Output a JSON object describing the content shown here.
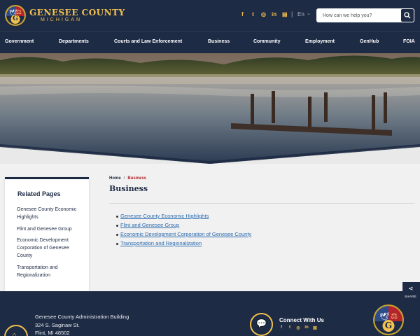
{
  "header": {
    "logo_title": "GENESEE COUNTY",
    "logo_subtitle": "MICHIGAN",
    "social": [
      {
        "icon": "facebook-icon",
        "glyph": "f"
      },
      {
        "icon": "twitter-icon",
        "glyph": "t"
      },
      {
        "icon": "instagram-icon",
        "glyph": "◎"
      },
      {
        "icon": "linkedin-icon",
        "glyph": "in"
      },
      {
        "icon": "news-icon",
        "glyph": "▤"
      }
    ],
    "language": "En",
    "language_caret": "⌄",
    "search_placeholder": "How can we help you?"
  },
  "nav": {
    "items": [
      "Government",
      "Departments",
      "Courts and Law Enforcement",
      "Business",
      "Community",
      "Employment",
      "GenHub",
      "FOIA"
    ]
  },
  "sidebar": {
    "title": "Related Pages",
    "links": [
      "Genesee County Economic Highlights",
      "Flint and Genesee Group",
      "Economic Development Corporation of Genesee County",
      "Transportation and Regionalization"
    ]
  },
  "breadcrumb": {
    "home": "Home",
    "separator": "/",
    "current": "Business"
  },
  "page_title": "Business",
  "content_links": [
    "Genesee County Economic Highlights",
    "Flint and Genesee Group",
    "Economic Development Corporation of Genesee County",
    "Transportation and Regionalization"
  ],
  "share": {
    "label": "SHARE",
    "icon": "share-icon"
  },
  "footer": {
    "address_lines": [
      "Genesee County Administration Building",
      "324 S. Saginaw St.",
      "Flint, MI  48502"
    ],
    "connect_title": "Connect With Us"
  },
  "colors": {
    "navy": "#1e2b44",
    "gold": "#f2c14e",
    "link": "#2b6cb0",
    "breadcrumb_current": "#b5232c"
  }
}
